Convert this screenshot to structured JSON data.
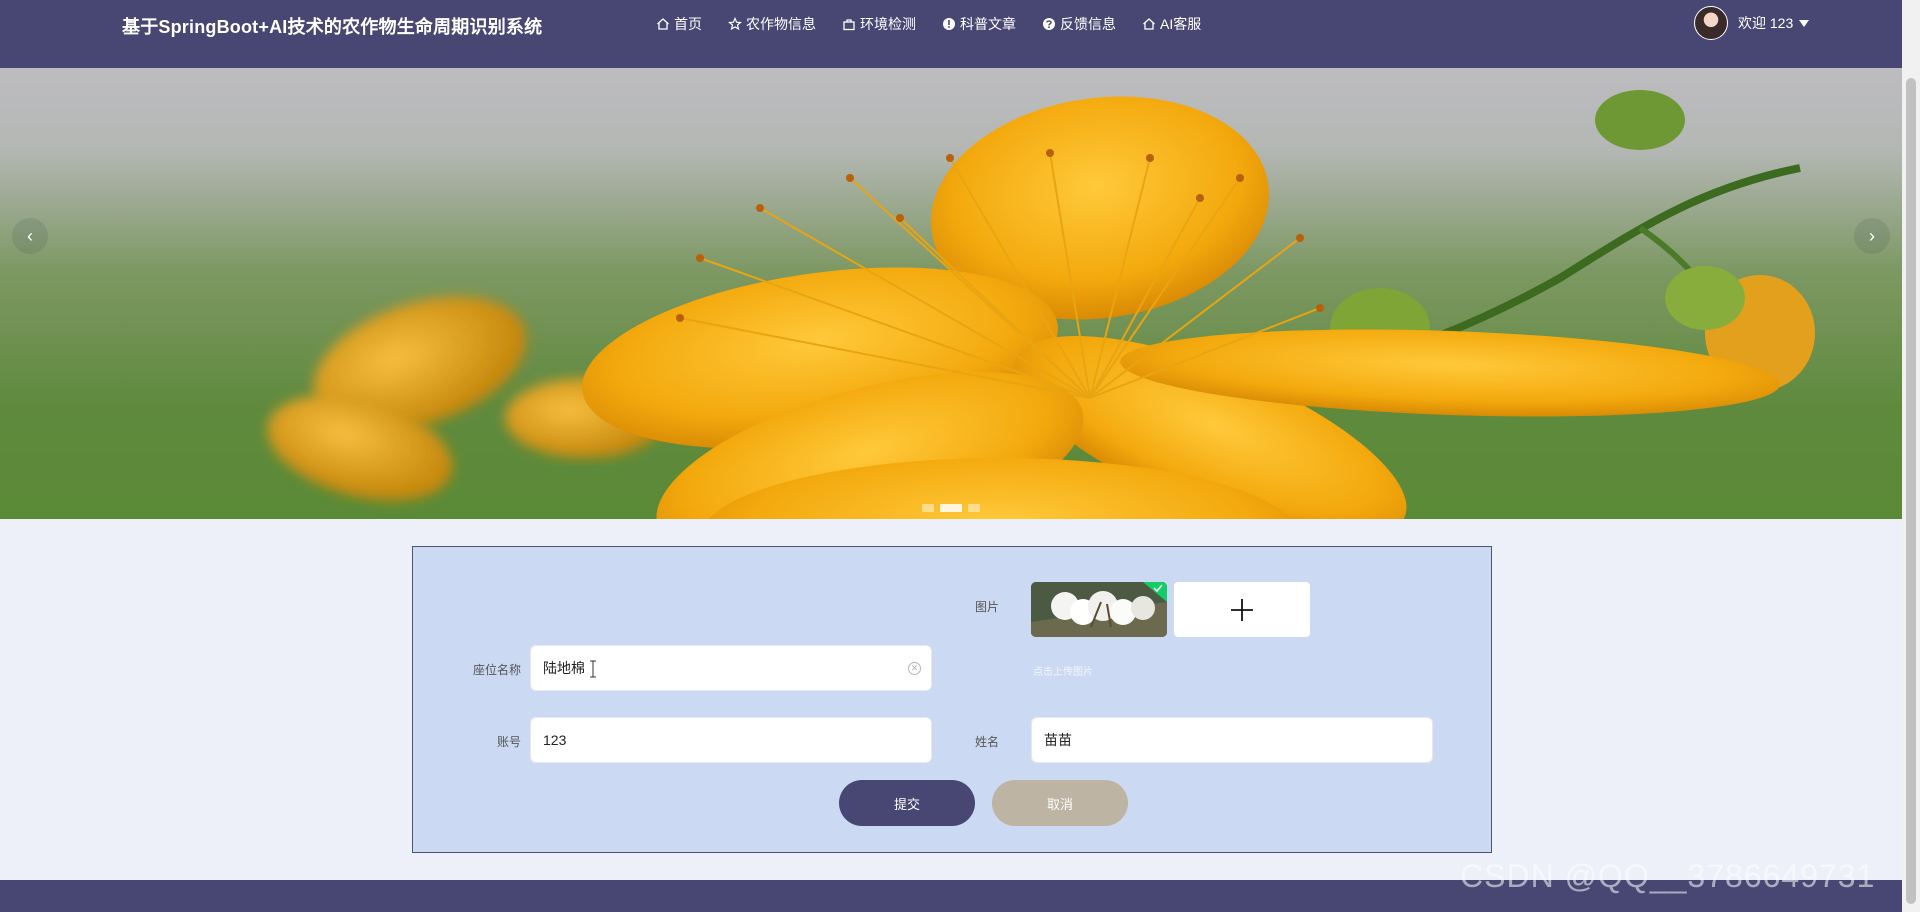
{
  "header": {
    "site_title": "基于SpringBoot+AI技术的农作物生命周期识别系统",
    "nav": [
      {
        "label": "首页",
        "icon": "home-icon"
      },
      {
        "label": "农作物信息",
        "icon": "star-icon"
      },
      {
        "label": "环境检测",
        "icon": "bag-icon"
      },
      {
        "label": "科普文章",
        "icon": "info-icon"
      },
      {
        "label": "反馈信息",
        "icon": "question-icon"
      },
      {
        "label": "AI客服",
        "icon": "home-icon"
      }
    ],
    "welcome": "欢迎 123"
  },
  "carousel": {
    "slide_count": 3,
    "active_index": 1,
    "prev": "‹",
    "next": "›"
  },
  "form": {
    "image_label": "图片",
    "image_hint": "点击上传图片",
    "name_label": "座位名称",
    "name_value": "陆地棉",
    "account_label": "账号",
    "account_value": "123",
    "realname_label": "姓名",
    "realname_value": "苗苗",
    "submit_label": "提交",
    "cancel_label": "取消"
  },
  "watermark": "CSDN @QQ__3786649731",
  "colors": {
    "header_bg": "#484672",
    "form_bg": "#cbd9f2",
    "submit_bg": "#484672",
    "cancel_bg": "#bdb4a4",
    "page_bg": "#edf0f8"
  }
}
